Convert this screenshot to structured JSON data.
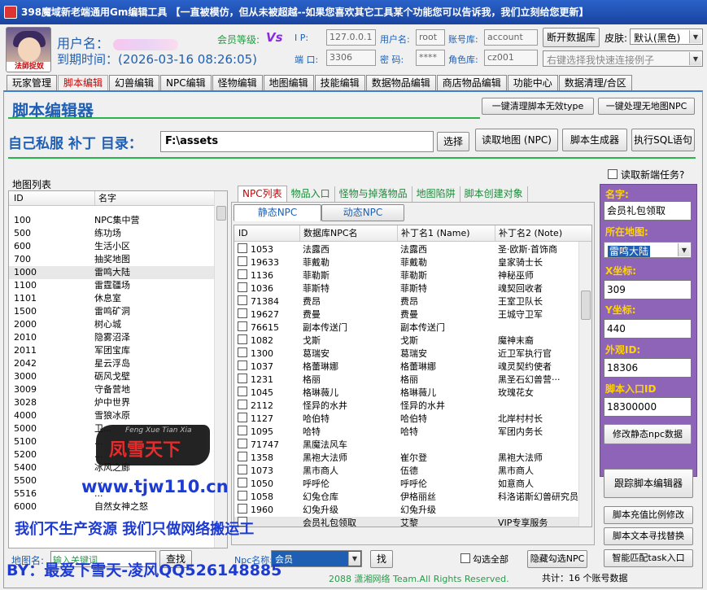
{
  "window": {
    "title": "398魔域新老端通用Gm编辑工具 【一直被模仿，但从未被超越--如果您喜欢其它工具某个功能您可以告诉我，我们立刻给您更新】"
  },
  "header": {
    "avatar_tag": "法師捉奴",
    "user_label": "用户名：",
    "expire_label": "到期时间：",
    "expire_value": "(2026-03-16 08:26:05)",
    "member_label": "会员等级:",
    "member_badge": "Vs",
    "ip_label": "I  P:",
    "ip_value": "127.0.0.1",
    "port_label": "端 口:",
    "port_value": "3306",
    "dbuser_label": "用户名:",
    "dbuser_value": "root",
    "dbpass_label": "密  码:",
    "dbpass_value": "****",
    "account_db_label": "账号库:",
    "account_db_value": "account",
    "role_db_label": "角色库:",
    "role_db_value": "cz001",
    "open_db_button": "断开数据库",
    "skin_label": "皮肤:",
    "skin_value": "默认(黑色)",
    "quick_connect_placeholder": "右键选择我快速连接例子"
  },
  "main_tabs": [
    "玩家管理",
    "脚本编辑",
    "幻兽编辑",
    "NPC编辑",
    "怪物编辑",
    "地图编辑",
    "技能编辑",
    "数据物品编辑",
    "商店物品编辑",
    "功能中心",
    "数据清理/合区"
  ],
  "active_main_tab": 1,
  "editor": {
    "title": "脚本编辑器",
    "clean_type_button": "一键清理脚本无效type",
    "clean_npc_button": "一键处理无地图NPC",
    "patch_label": "自己私服 补丁 目录：",
    "patch_path": "F:\\assets",
    "browse_button": "选择",
    "read_map_button": "读取地图 (NPC)",
    "script_gen_button": "脚本生成器",
    "exec_sql_button": "执行SQL语句",
    "read_new_task_label": "读取新端任务?"
  },
  "map_list": {
    "title": "地图列表",
    "columns": [
      "ID",
      "名字"
    ],
    "rows": [
      [
        "100",
        "NPC集中营"
      ],
      [
        "500",
        "练功场"
      ],
      [
        "600",
        "生活小区"
      ],
      [
        "700",
        "抽奖地图"
      ],
      [
        "1000",
        "雷鸣大陆"
      ],
      [
        "1100",
        "雷霆疆场"
      ],
      [
        "1101",
        "休息室"
      ],
      [
        "1500",
        "雷鸣矿洞"
      ],
      [
        "2000",
        "树心城"
      ],
      [
        "2010",
        "隐雾沼泽"
      ],
      [
        "2011",
        "军团宝库"
      ],
      [
        "2042",
        "星云浮岛"
      ],
      [
        "3000",
        "砺风戈壁"
      ],
      [
        "3009",
        "守备营地"
      ],
      [
        "3028",
        "炉中世界"
      ],
      [
        "4000",
        "雪狼冰原"
      ],
      [
        "5000",
        "卫..."
      ],
      [
        "5100",
        "..."
      ],
      [
        "5200",
        "..."
      ],
      [
        "5400",
        "冰风之廊"
      ],
      [
        "5500",
        "..."
      ],
      [
        "5516",
        "..."
      ],
      [
        "6000",
        "自然女神之怒"
      ]
    ],
    "search_label": "地图名:",
    "search_value": "输入关键词",
    "search_button": "查找"
  },
  "sub_tabs": [
    "NPC列表",
    "物品入口",
    "怪物与掉落物品",
    "地图陷阱",
    "脚本创建对象"
  ],
  "npc_tabs": [
    "静态NPC",
    "动态NPC"
  ],
  "npc_grid": {
    "columns": [
      "ID",
      "数据库NPC名",
      "补丁名1 (Name)",
      "补丁名2 (Note)"
    ],
    "rows": [
      [
        "1053",
        "法露西",
        "法露西",
        "圣·欧斯·首饰商"
      ],
      [
        "19633",
        "菲戴勒",
        "菲戴勒",
        "皇家骑士长"
      ],
      [
        "1136",
        "菲勒斯",
        "菲勒斯",
        "神秘巫师"
      ],
      [
        "1036",
        "菲斯特",
        "菲斯特",
        "魂契回收者"
      ],
      [
        "71384",
        "费昂",
        "费昂",
        "王室卫队长"
      ],
      [
        "19627",
        "费曼",
        "费曼",
        "王城守卫军"
      ],
      [
        "76615",
        "副本传送门",
        "副本传送门",
        ""
      ],
      [
        "1082",
        "戈斯",
        "戈斯",
        "魔神末裔"
      ],
      [
        "1300",
        "葛瑞安",
        "葛瑞安",
        "近卫军执行官"
      ],
      [
        "1037",
        "格蕾琳娜",
        "格蕾琳娜",
        "魂灵契约使者"
      ],
      [
        "1231",
        "格丽",
        "格丽",
        "黑圣石幻兽营···"
      ],
      [
        "1045",
        "格琳薇儿",
        "格琳薇儿",
        "玫瑰花女"
      ],
      [
        "2112",
        "怪异的水井",
        "怪异的水井",
        ""
      ],
      [
        "1127",
        "哈伯特",
        "哈伯特",
        "北岸村村长"
      ],
      [
        "1095",
        "哈特",
        "哈特",
        "军团内务长"
      ],
      [
        "71747",
        "黑魔法风车",
        "",
        ""
      ],
      [
        "1358",
        "黑袍大法师",
        "崔尔登",
        "黑袍大法师"
      ],
      [
        "1073",
        "黑市商人",
        "伍德",
        "黑市商人"
      ],
      [
        "1050",
        "呼呼伦",
        "呼呼伦",
        "如意商人"
      ],
      [
        "1058",
        "幻兔仓库",
        "伊格丽丝",
        "科洛诺斯幻兽研究员"
      ],
      [
        "1960",
        "幻兔升级",
        "幻兔升级",
        ""
      ],
      [
        "",
        "会员礼包领取",
        "艾黎",
        "VIP专享服务"
      ]
    ],
    "search_label": "Npc名称:",
    "search_value": "会员",
    "search_button": "找",
    "check_all_label": "勾选全部",
    "hide_button": "隐藏勾选NPC",
    "footer_left": "2088  潇湘网络 Team.All Rights Reserved.",
    "footer_right": "共计：16 个账号数据"
  },
  "npc_detail": {
    "name_label": "名字:",
    "name_value": "会员礼包领取",
    "map_label": "所在地图:",
    "map_value": "雷鸣大陆",
    "x_label": "X坐标:",
    "x_value": "309",
    "y_label": "Y坐标:",
    "y_value": "440",
    "look_label": "外观ID:",
    "look_value": "18306",
    "entry_label": "脚本入口ID",
    "entry_value": "18300000",
    "modify_button": "修改静态npc数据",
    "track_button": "跟踪脚本编辑器",
    "recharge_button": "脚本充值比例修改",
    "find_replace_button": "脚本文本寻找替换",
    "smart_match_button": "智能匹配task入口"
  },
  "watermark": {
    "logo": "凤雪天下",
    "logo_small": "Feng Xue Tian Xia",
    "url": "www.tjw110.cn",
    "slogan": "我们不生产资源 我们只做网络搬运工",
    "by": "BY：最爱下雪天-凌风QQ526148885"
  }
}
